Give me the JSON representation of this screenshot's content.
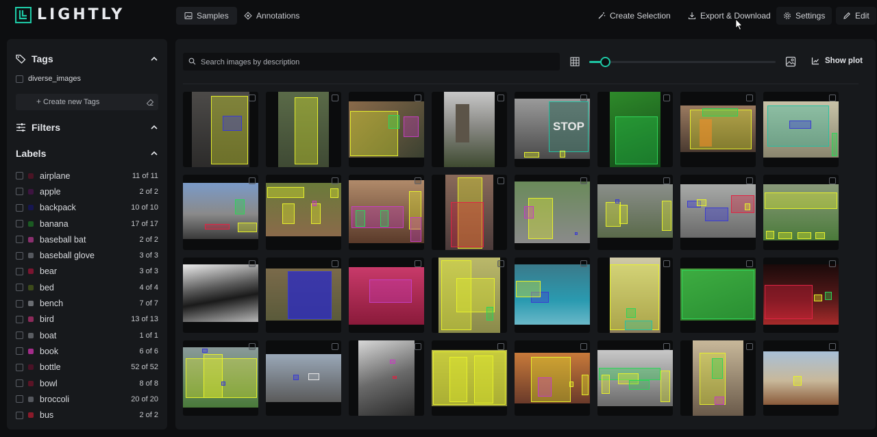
{
  "app": {
    "brand": "LIGHTLY"
  },
  "nav": {
    "samples": "Samples",
    "annotations": "Annotations"
  },
  "actions": {
    "create_selection": "Create Selection",
    "export": "Export & Download",
    "settings": "Settings",
    "edit": "Edit"
  },
  "sidebar": {
    "tags_title": "Tags",
    "tags": [
      {
        "label": "diverse_images",
        "checked": false
      }
    ],
    "create_tag": "Create new Tags",
    "filters_title": "Filters",
    "labels_title": "Labels",
    "labels": [
      {
        "name": "airplane",
        "count": "11 of 11",
        "color": "#4a1424"
      },
      {
        "name": "apple",
        "count": "2 of 2",
        "color": "#3d1440"
      },
      {
        "name": "backpack",
        "count": "10 of 10",
        "color": "#161650"
      },
      {
        "name": "banana",
        "count": "17 of 17",
        "color": "#1b5a22"
      },
      {
        "name": "baseball bat",
        "count": "2 of 2",
        "color": "#8a2f6e"
      },
      {
        "name": "baseball glove",
        "count": "3 of 3",
        "color": "#55585e"
      },
      {
        "name": "bear",
        "count": "3 of 3",
        "color": "#7a1530"
      },
      {
        "name": "bed",
        "count": "4 of 4",
        "color": "#3c4a1a"
      },
      {
        "name": "bench",
        "count": "7 of 7",
        "color": "#6a6d72"
      },
      {
        "name": "bird",
        "count": "13 of 13",
        "color": "#8c2a5a"
      },
      {
        "name": "boat",
        "count": "1 of 1",
        "color": "#5a5d62"
      },
      {
        "name": "book",
        "count": "6 of 6",
        "color": "#a32c8a"
      },
      {
        "name": "bottle",
        "count": "52 of 52",
        "color": "#4a1226"
      },
      {
        "name": "bowl",
        "count": "8 of 8",
        "color": "#5a1426"
      },
      {
        "name": "broccoli",
        "count": "20 of 20",
        "color": "#55585e"
      },
      {
        "name": "bus",
        "count": "2 of 2",
        "color": "#8a1a2a"
      }
    ]
  },
  "main": {
    "search_placeholder": "Search images by description",
    "show_plot": "Show plot",
    "thumbnail_size": 0.06,
    "stop_sign_text": "STOP"
  },
  "colors": {
    "accent": "#1ec8a5",
    "yellow_box": "#e7f12c",
    "green_box": "#2fd45a",
    "red_box": "#e02444",
    "purple_box": "#c43ec0",
    "blue_box": "#3a3bd0"
  }
}
